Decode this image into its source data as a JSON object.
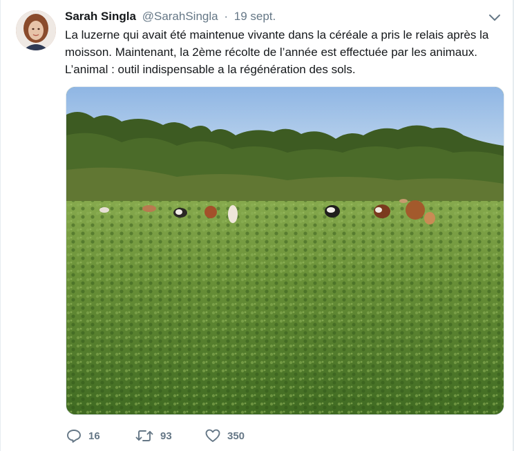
{
  "tweet": {
    "author_name": "Sarah Singla",
    "handle": "@SarahSingla",
    "separator": "·",
    "date": "19 sept.",
    "text_lines": [
      "La luzerne qui avait été maintenue vivante dans la céréale a pris le relais après la",
      "moisson. Maintenant, la 2ème récolte de l’année est effectuée par les animaux.",
      "L’animal : outil indispensable a la régénération des sols."
    ]
  },
  "actions": {
    "reply_count": "16",
    "retweet_count": "93",
    "like_count": "350"
  },
  "icons": {
    "reply": "reply-icon",
    "retweet": "retweet-icon",
    "like": "heart-icon",
    "menu": "chevron-down-icon"
  },
  "colors": {
    "text": "#14171a",
    "secondary": "#657786",
    "sky": "#a7c6e8",
    "field": "#5f8a34",
    "trees": "#3f5a24"
  }
}
